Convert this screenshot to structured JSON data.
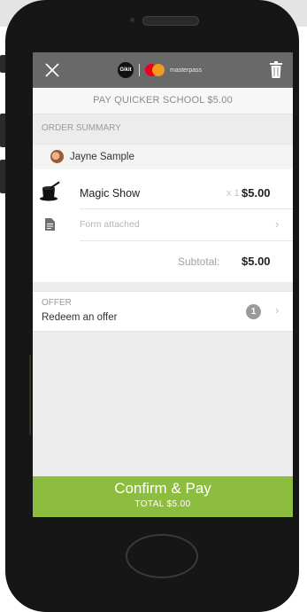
{
  "header": {
    "brand_badge": "Gikit",
    "brand_name": "masterpass"
  },
  "pay_bar": {
    "text": "PAY QUICKER SCHOOL $5.00"
  },
  "order_summary": {
    "label": "ORDER SUMMARY",
    "customer": "Jayne Sample",
    "items": [
      {
        "name": "Magic Show",
        "qty": "x 1",
        "price": "$5.00",
        "form": "Form attached"
      }
    ],
    "subtotal_label": "Subtotal:",
    "subtotal_value": "$5.00"
  },
  "offer": {
    "label": "OFFER",
    "text": "Redeem an offer",
    "count": "1"
  },
  "confirm": {
    "title": "Confirm & Pay",
    "total": "TOTAL $5.00"
  },
  "colors": {
    "accent_green": "#8dbd3f",
    "topbar": "#696969",
    "mastercard_red": "#eb001b",
    "mastercard_orange": "#f79e1b"
  },
  "icons": [
    "close-icon",
    "mastercard-logo",
    "trash-icon",
    "avatar",
    "magic-hat-icon",
    "document-icon",
    "chevron-right-icon",
    "offer-count-badge"
  ]
}
